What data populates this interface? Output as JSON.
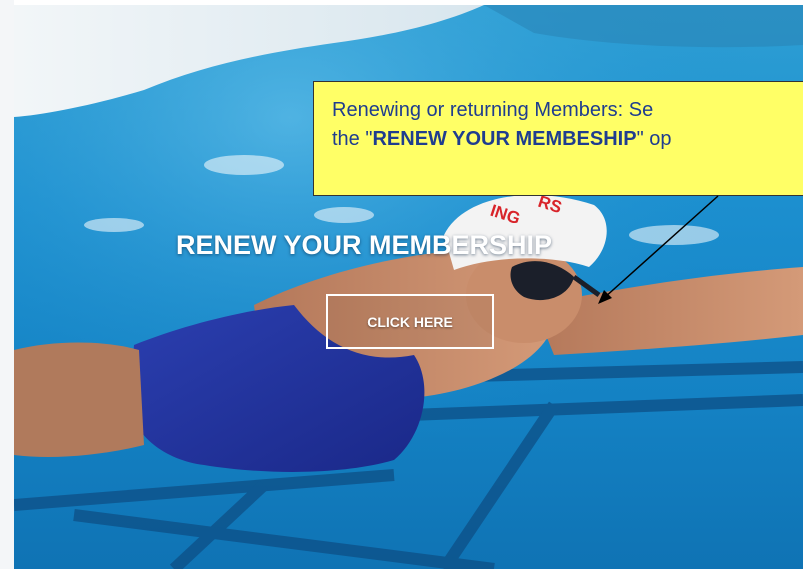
{
  "hero": {
    "title": "RENEW YOUR MEMBERSHIP",
    "cta_label": "CLICK HERE",
    "image_icon": "swimmer-photo",
    "cap_text_top": "RS",
    "cap_text_bottom": "ING"
  },
  "callout": {
    "line1": "Renewing or returning Members: Se",
    "line2_prefix": "the \"",
    "line2_bold": "RENEW YOUR MEMBESHIP",
    "line2_suffix": "\" op",
    "background": "#ffff66",
    "text_color": "#1f3d8f"
  }
}
